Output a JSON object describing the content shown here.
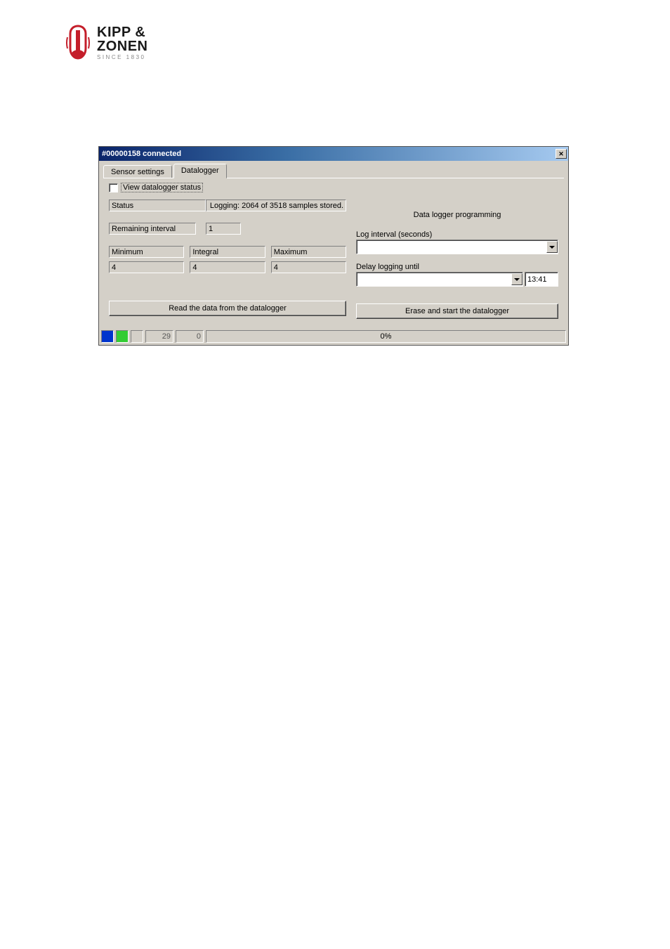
{
  "logo": {
    "line1": "KIPP &",
    "line2": "ZONEN",
    "tagline": "SINCE 1830"
  },
  "window": {
    "title": "#00000158 connected"
  },
  "tabs": {
    "sensor": "Sensor settings",
    "datalogger": "Datalogger"
  },
  "left": {
    "view_status_label": "View datalogger status",
    "status_label": "Status",
    "status_value": "Logging: 2064 of 3518 samples stored.",
    "remaining_label": "Remaining interval",
    "remaining_value": "1",
    "min_label": "Minimum",
    "min_value": "4",
    "int_label": "Integral",
    "int_value": "4",
    "max_label": "Maximum",
    "max_value": "4",
    "read_button": "Read the data from the datalogger"
  },
  "right": {
    "heading": "Data logger programming",
    "interval_label": "Log interval (seconds)",
    "delay_label": "Delay logging until",
    "time_value": "13:41",
    "erase_button": "Erase and start the datalogger"
  },
  "statusbar": {
    "num1": "29",
    "num2": "0",
    "progress": "0%"
  }
}
